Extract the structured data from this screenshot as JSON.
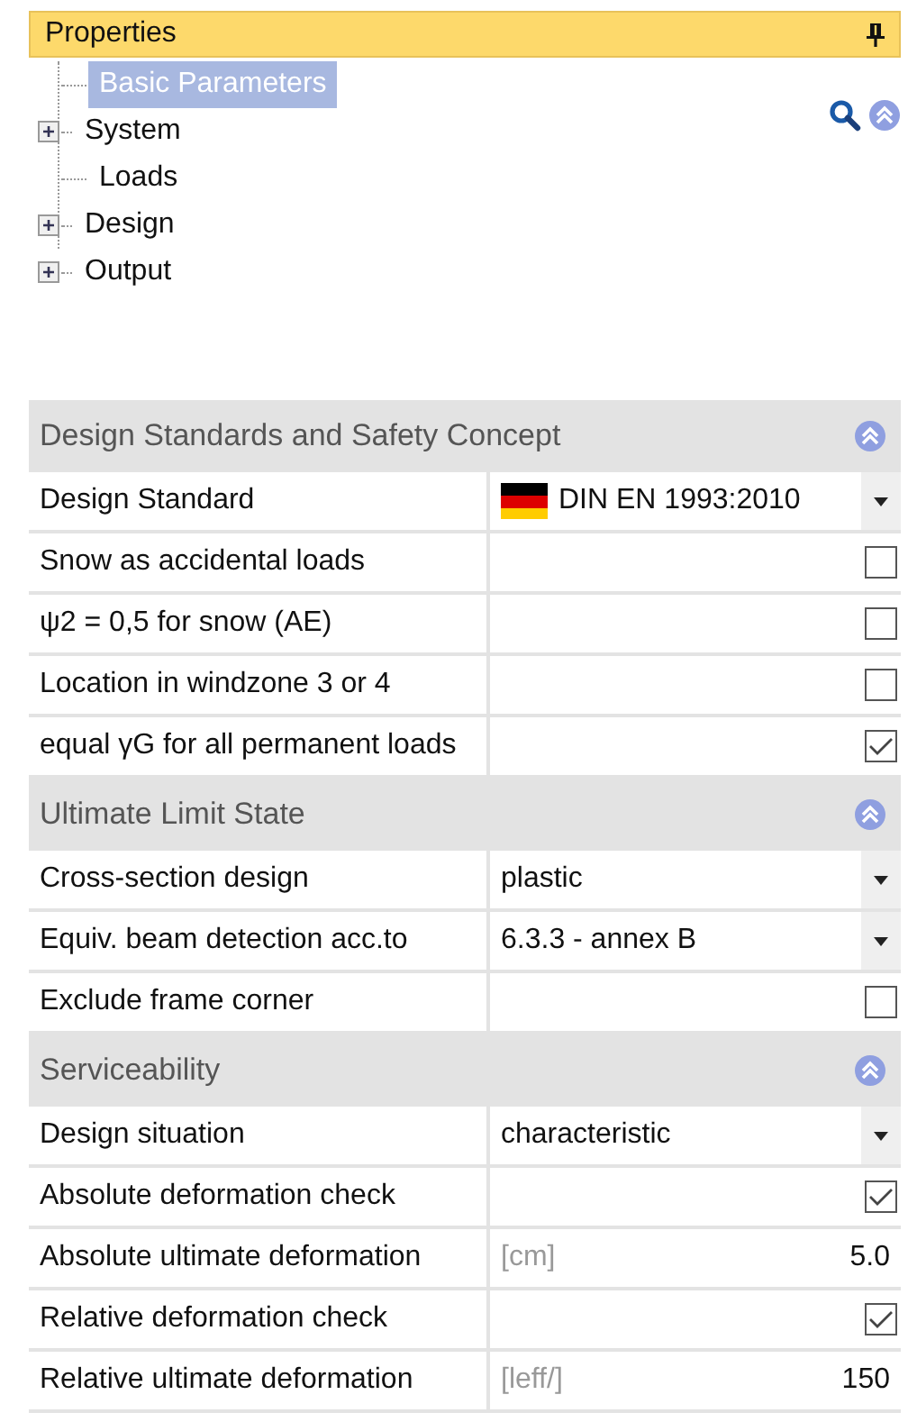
{
  "panel": {
    "title": "Properties"
  },
  "tree": [
    {
      "label": "Basic Parameters",
      "selected": true,
      "expandable": false
    },
    {
      "label": "System",
      "selected": false,
      "expandable": true
    },
    {
      "label": "Loads",
      "selected": false,
      "expandable": false
    },
    {
      "label": "Design",
      "selected": false,
      "expandable": true
    },
    {
      "label": "Output",
      "selected": false,
      "expandable": true
    }
  ],
  "sections": [
    {
      "title": "Design Standards and Safety Concept",
      "expanded": true,
      "rows": [
        {
          "kind": "flag-dropdown",
          "label": "Design Standard",
          "value": "DIN EN 1993:2010"
        },
        {
          "kind": "checkbox",
          "label": "Snow as accidental loads",
          "checked": false
        },
        {
          "kind": "checkbox",
          "label": "ψ2 = 0,5 for snow (AE)",
          "checked": false
        },
        {
          "kind": "checkbox",
          "label": "Location in windzone 3 or 4",
          "checked": false
        },
        {
          "kind": "checkbox",
          "label": "equal γG for all permanent loads",
          "checked": true
        }
      ]
    },
    {
      "title": "Ultimate Limit State",
      "expanded": true,
      "rows": [
        {
          "kind": "dropdown",
          "label": "Cross-section design",
          "value": "plastic"
        },
        {
          "kind": "dropdown",
          "label": "Equiv. beam detection acc.to",
          "value": "6.3.3 - annex B"
        },
        {
          "kind": "checkbox",
          "label": "Exclude frame corner",
          "checked": false
        }
      ]
    },
    {
      "title": "Serviceability",
      "expanded": true,
      "rows": [
        {
          "kind": "dropdown",
          "label": "Design situation",
          "value": "characteristic"
        },
        {
          "kind": "checkbox",
          "label": "Absolute deformation check",
          "checked": true
        },
        {
          "kind": "number",
          "label": "Absolute ultimate deformation",
          "unit": "[cm]",
          "value": "5.0"
        },
        {
          "kind": "checkbox",
          "label": "Relative deformation check",
          "checked": true
        },
        {
          "kind": "number",
          "label": "Relative ultimate deformation",
          "unit": "[leff/]",
          "value": "150"
        }
      ]
    }
  ]
}
